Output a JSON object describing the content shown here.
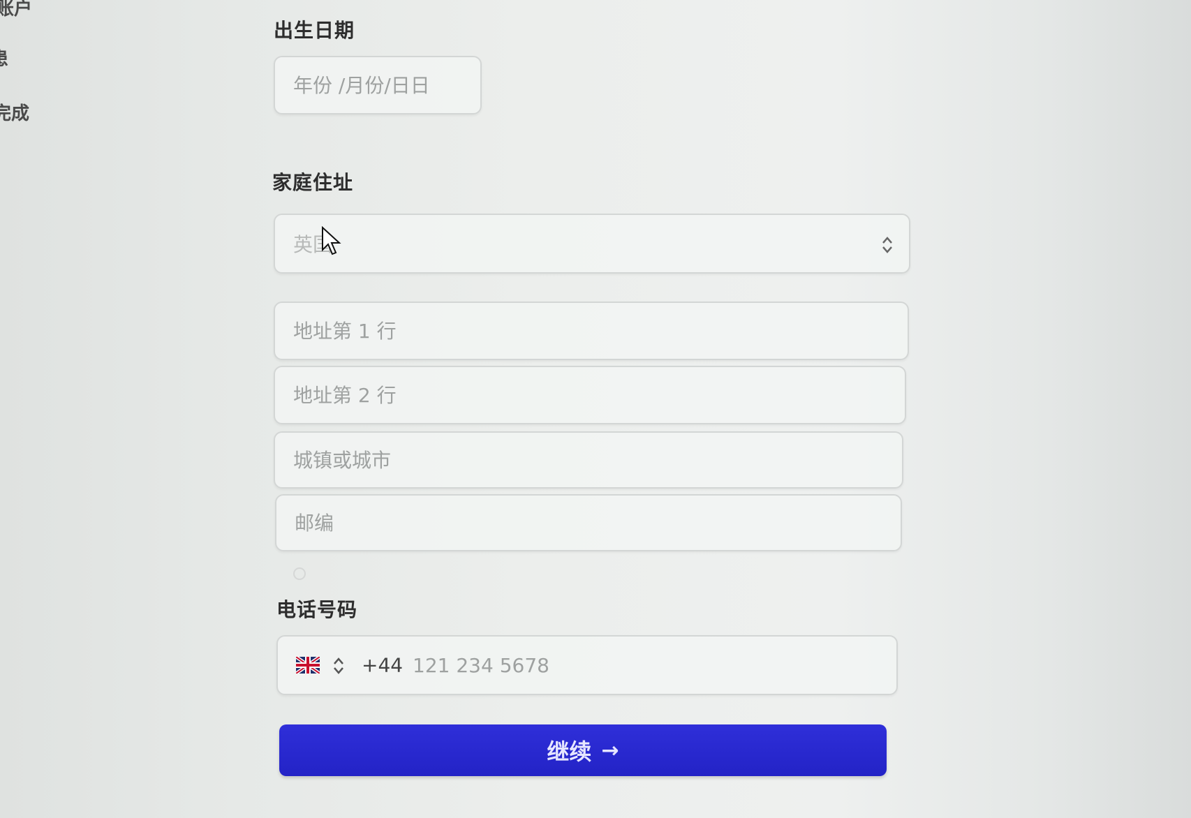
{
  "nav": {
    "items": [
      "账户",
      "患",
      "完成"
    ]
  },
  "dob": {
    "label": "出生日期",
    "placeholder": "年份 /月份/日日"
  },
  "address": {
    "label": "家庭住址",
    "country_value": "英国",
    "line1_placeholder": "地址第 1 行",
    "line2_placeholder": "地址第 2 行",
    "city_placeholder": "城镇或城市",
    "postcode_placeholder": "邮编"
  },
  "phone": {
    "label": "电话号码",
    "country_code": "+44",
    "placeholder": "121 234 5678",
    "flag_icon": "uk-flag-icon"
  },
  "continue_button": {
    "label": "继续",
    "icon": "arrow-right-icon"
  },
  "colors": {
    "accent": "#2a2ad0"
  }
}
